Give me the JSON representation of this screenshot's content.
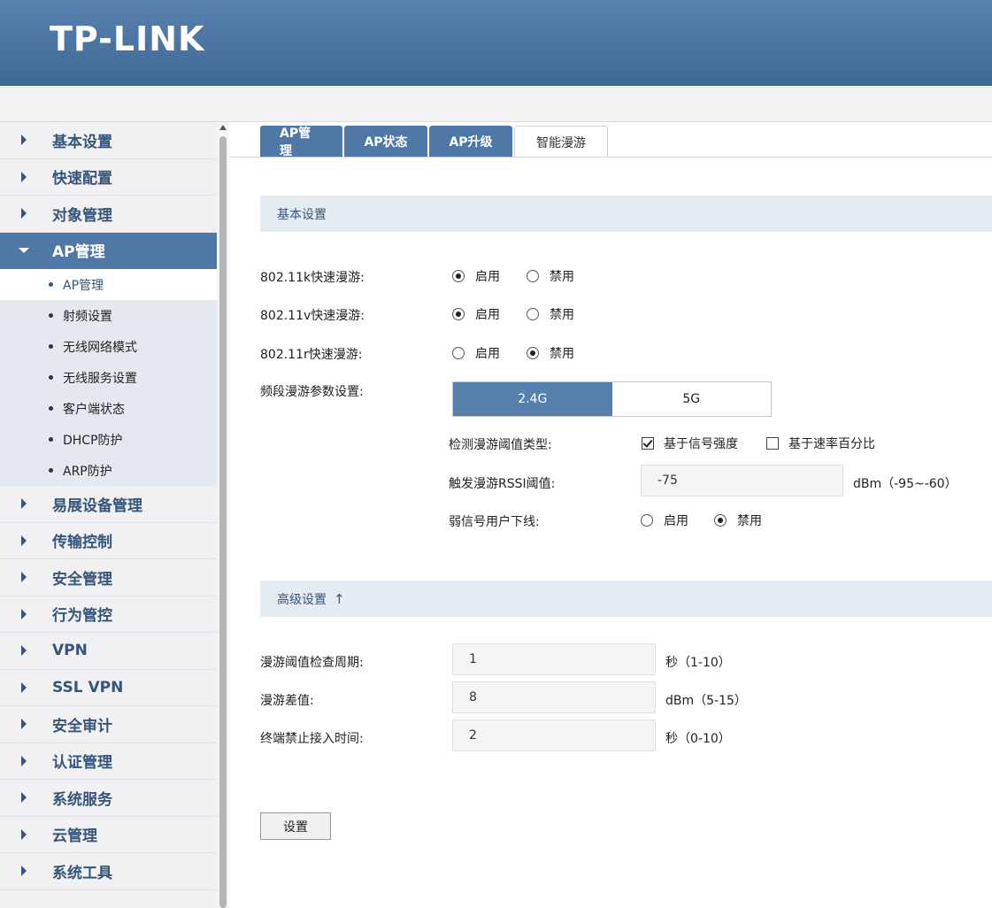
{
  "brand": {
    "logo_text": "TP-LINK"
  },
  "sidebar": {
    "items_top": [
      {
        "label": "基本设置"
      },
      {
        "label": "快速配置"
      },
      {
        "label": "对象管理"
      }
    ],
    "active_item": {
      "label": "AP管理"
    },
    "sub_items": [
      {
        "label": "AP管理"
      },
      {
        "label": "射频设置"
      },
      {
        "label": "无线网络模式"
      },
      {
        "label": "无线服务设置"
      },
      {
        "label": "客户端状态"
      },
      {
        "label": "DHCP防护"
      },
      {
        "label": "ARP防护"
      }
    ],
    "items_bottom": [
      {
        "label": "易展设备管理"
      },
      {
        "label": "传输控制"
      },
      {
        "label": "安全管理"
      },
      {
        "label": "行为管控"
      },
      {
        "label": "VPN"
      },
      {
        "label": "SSL VPN"
      },
      {
        "label": "安全审计"
      },
      {
        "label": "认证管理"
      },
      {
        "label": "系统服务"
      },
      {
        "label": "云管理"
      },
      {
        "label": "系统工具"
      }
    ]
  },
  "tabs": [
    {
      "label": "AP管理"
    },
    {
      "label": "AP状态"
    },
    {
      "label": "AP升级"
    },
    {
      "label": "智能漫游"
    }
  ],
  "basic": {
    "title": "基本设置",
    "k_label": "802.11k快速漫游:",
    "v_label": "802.11v快速漫游:",
    "r_label": "802.11r快速漫游:",
    "enable": "启用",
    "disable": "禁用",
    "k_value": "启用",
    "v_value": "启用",
    "r_value": "禁用",
    "band_label": "频段漫游参数设置:",
    "band_24": "2.4G",
    "band_5": "5G",
    "band_selected": "2.4G",
    "threshold_type_label": "检测漫游阈值类型:",
    "signal_strength": "基于信号强度",
    "rate_percent": "基于速率百分比",
    "rssi_label": "触发漫游RSSI阈值:",
    "rssi_value": "-75",
    "rssi_unit": "dBm（-95~-60）",
    "weak_label": "弱信号用户下线:",
    "weak_value": "禁用"
  },
  "advanced": {
    "title": "高级设置",
    "arrow": "↑",
    "period_label": "漫游阈值检查周期:",
    "period_value": "1",
    "period_unit": "秒（1-10）",
    "diff_label": "漫游差值:",
    "diff_value": "8",
    "diff_unit": "dBm（5-15）",
    "ban_label": "终端禁止接入时间:",
    "ban_value": "2",
    "ban_unit": "秒（0-10）"
  },
  "actions": {
    "set_label": "设置"
  }
}
